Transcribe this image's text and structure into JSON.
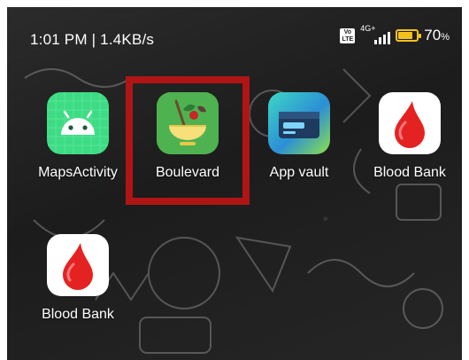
{
  "status_bar": {
    "time_speed": "1:01 PM | 1.4KB/s",
    "volte": "Vo LTE",
    "network": "4G+",
    "battery_percent": "70",
    "battery_unit": "%",
    "battery_level": 0.7
  },
  "apps": [
    {
      "label": "MapsActivity",
      "icon": "android-icon"
    },
    {
      "label": "Boulevard",
      "icon": "salad-bowl-icon"
    },
    {
      "label": "App vault",
      "icon": "card-vault-icon"
    },
    {
      "label": "Blood Bank",
      "icon": "blood-drop-icon"
    },
    {
      "label": "Blood Bank",
      "icon": "blood-drop-icon"
    }
  ],
  "colors": {
    "highlight": "#b01515",
    "android_green": "#3ddc84",
    "boulevard_green": "#4caf50",
    "vault_blue": "#2bb6d6",
    "blood_red": "#e52222",
    "battery": "#f4c020"
  }
}
